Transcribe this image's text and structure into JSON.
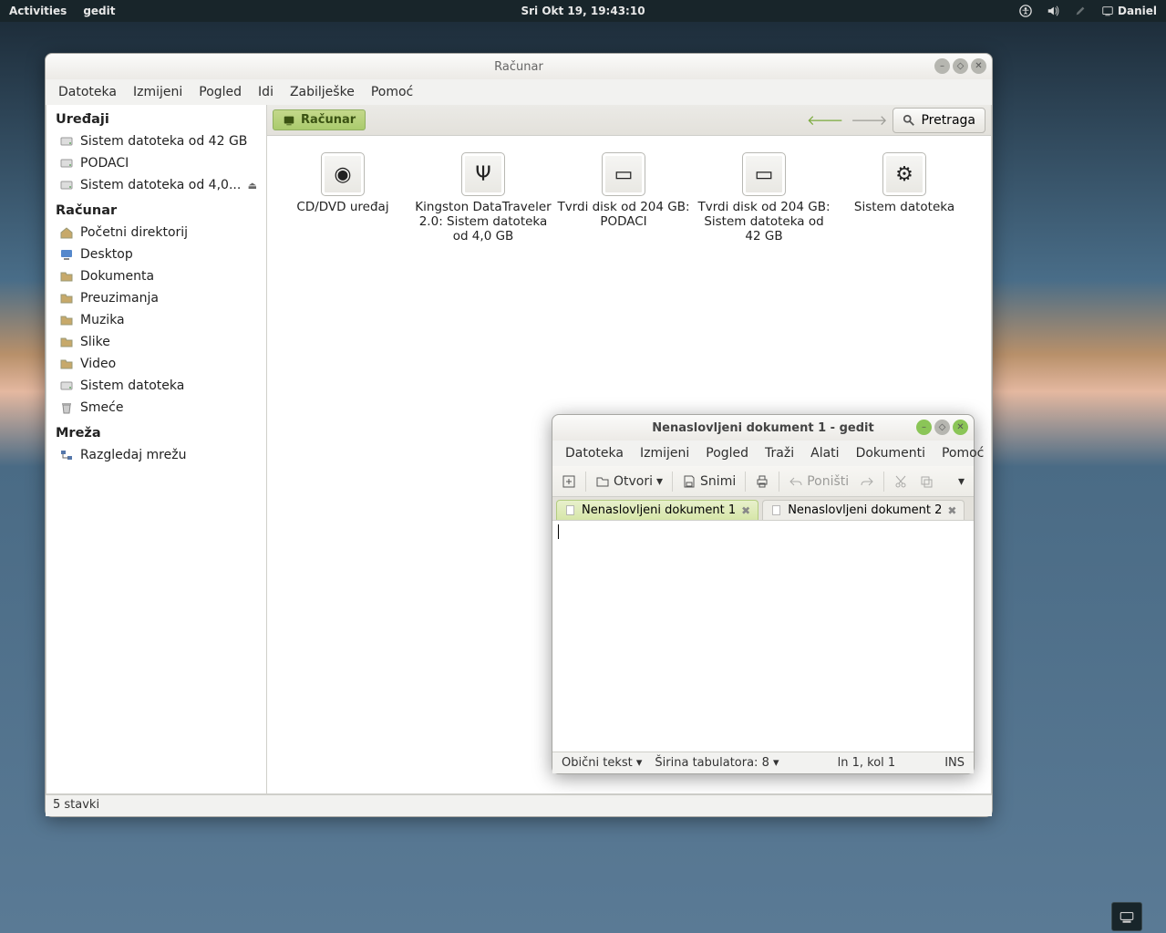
{
  "panel": {
    "activities": "Activities",
    "app": "gedit",
    "clock": "Sri Okt 19, 19:43:10",
    "user": "Daniel"
  },
  "fm": {
    "title": "Računar",
    "menu": [
      "Datoteka",
      "Izmijeni",
      "Pogled",
      "Idi",
      "Zabilješke",
      "Pomoć"
    ],
    "sidebar": {
      "devices_title": "Uređaji",
      "devices": [
        {
          "label": "Sistem datoteka od 42 GB",
          "icon": "drive"
        },
        {
          "label": "PODACI",
          "icon": "drive"
        },
        {
          "label": "Sistem datoteka od 4,0...",
          "icon": "drive",
          "eject": true
        }
      ],
      "computer_title": "Računar",
      "places": [
        {
          "label": "Početni direktorij",
          "icon": "home"
        },
        {
          "label": "Desktop",
          "icon": "desktop"
        },
        {
          "label": "Dokumenta",
          "icon": "folder"
        },
        {
          "label": "Preuzimanja",
          "icon": "folder"
        },
        {
          "label": "Muzika",
          "icon": "folder"
        },
        {
          "label": "Slike",
          "icon": "folder"
        },
        {
          "label": "Video",
          "icon": "folder"
        },
        {
          "label": "Sistem datoteka",
          "icon": "drive"
        },
        {
          "label": "Smeće",
          "icon": "trash"
        }
      ],
      "network_title": "Mreža",
      "network": [
        {
          "label": "Razgledaj mrežu",
          "icon": "network"
        }
      ]
    },
    "pathbar": {
      "location": "Računar",
      "search": "Pretraga"
    },
    "items": [
      {
        "label": "CD/DVD uređaj",
        "glyph": "◉"
      },
      {
        "label": "Kingston DataTraveler 2.0: Sistem datoteka od 4,0 GB",
        "glyph": "Ψ"
      },
      {
        "label": "Tvrdi disk od 204 GB: PODACI",
        "glyph": "▭"
      },
      {
        "label": "Tvrdi disk od 204 GB: Sistem datoteka od 42 GB",
        "glyph": "▭"
      },
      {
        "label": "Sistem datoteka",
        "glyph": "⚙"
      }
    ],
    "status": "5 stavki"
  },
  "gedit": {
    "title": "Nenaslovljeni dokument 1 - gedit",
    "menu": [
      "Datoteka",
      "Izmijeni",
      "Pogled",
      "Traži",
      "Alati",
      "Dokumenti",
      "Pomoć"
    ],
    "toolbar": {
      "open": "Otvori",
      "save": "Snimi",
      "undo": "Poništi"
    },
    "tabs": [
      {
        "label": "Nenaslovljeni dokument 1",
        "active": true
      },
      {
        "label": "Nenaslovljeni dokument 2",
        "active": false
      }
    ],
    "status": {
      "mode": "Obični tekst",
      "tabwidth_label": "Širina tabulatora:",
      "tabwidth": "8",
      "pos": "ln 1, kol 1",
      "ins": "INS"
    }
  }
}
